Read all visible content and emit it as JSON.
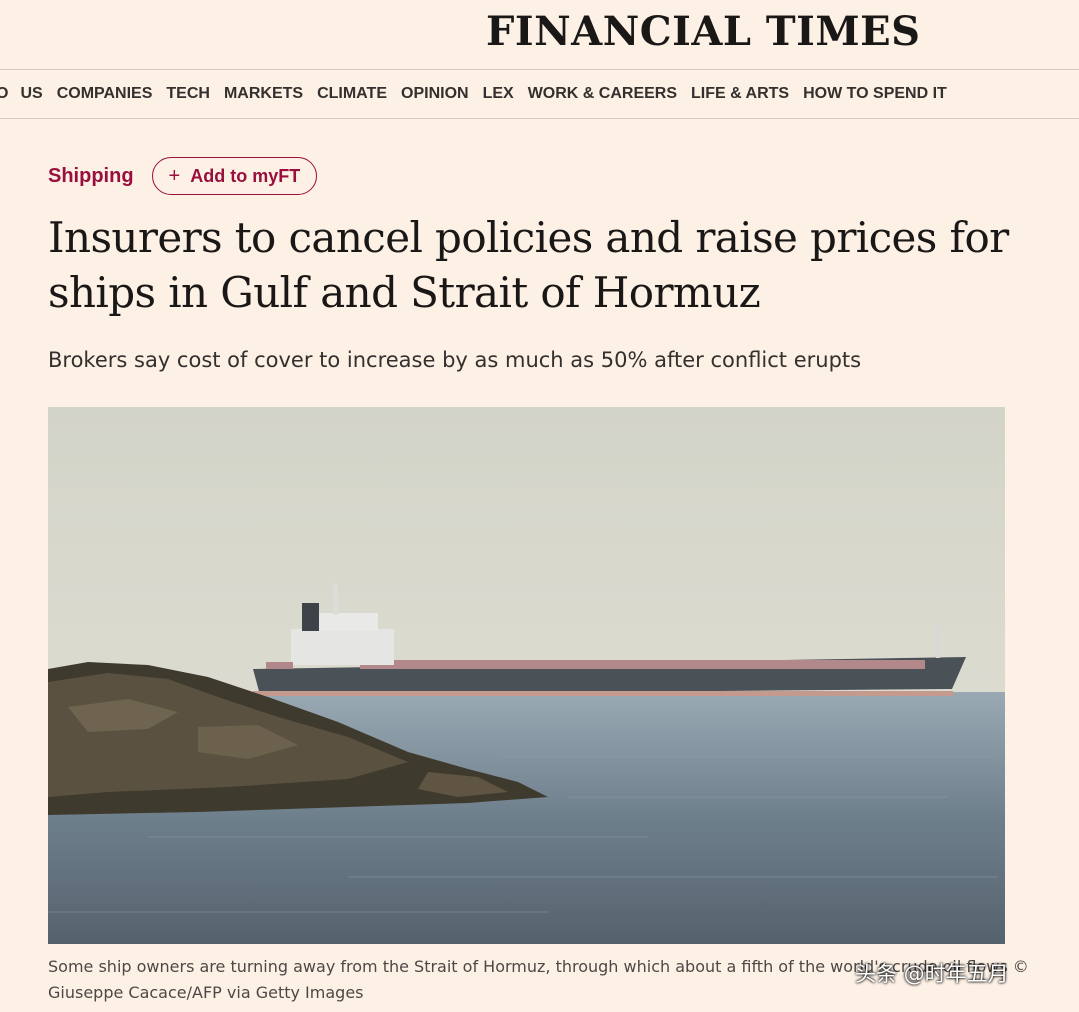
{
  "masthead": {
    "logo": "FINANCIAL TIMES"
  },
  "nav": {
    "edge_fragment": "O",
    "items": [
      "US",
      "COMPANIES",
      "TECH",
      "MARKETS",
      "CLIMATE",
      "OPINION",
      "LEX",
      "WORK & CAREERS",
      "LIFE & ARTS",
      "HOW TO SPEND IT"
    ]
  },
  "article": {
    "topic": "Shipping",
    "follow_button": {
      "icon": "plus-icon",
      "label": "Add to myFT"
    },
    "headline": "Insurers to cancel policies and raise prices for ships in Gulf and Strait of Hormuz",
    "standfirst": "Brokers say cost of cover to increase by as much as 50% after conflict erupts",
    "image_caption": "Some ship owners are turning away from the Strait of Hormuz, through which about a fifth of the world's crude oil flows © Giuseppe Cacace/AFP via Getty Images"
  },
  "watermark": "头条 @时年五月",
  "colors": {
    "background": "#fdf1e6",
    "accent": "#990f3d",
    "text": "#33302e"
  }
}
